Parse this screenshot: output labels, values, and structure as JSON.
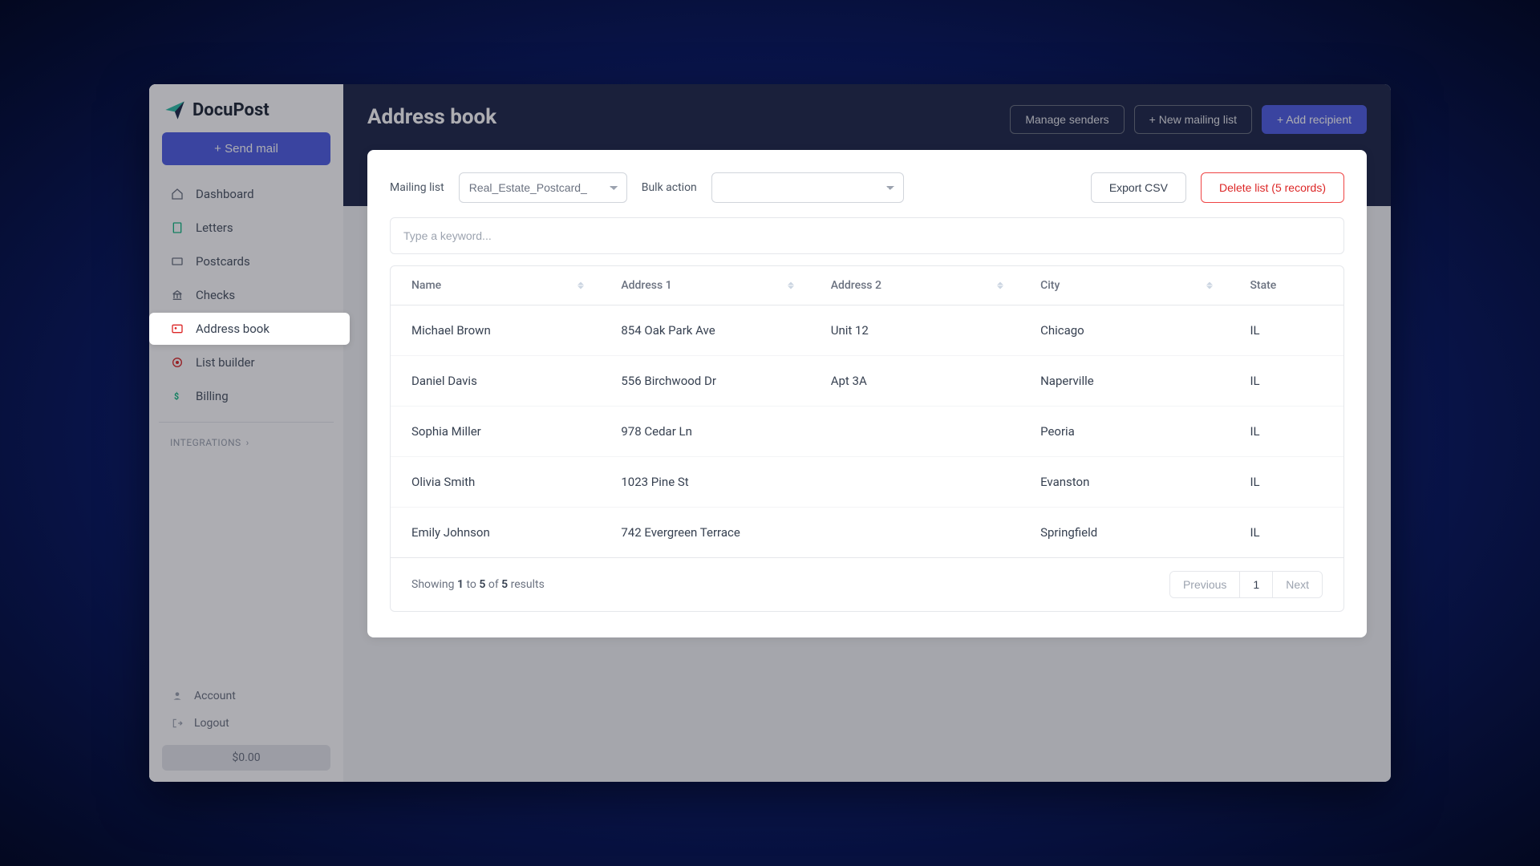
{
  "brand": {
    "name": "DocuPost"
  },
  "sidebar": {
    "send_mail": "+ Send mail",
    "items": [
      {
        "label": "Dashboard"
      },
      {
        "label": "Letters"
      },
      {
        "label": "Postcards"
      },
      {
        "label": "Checks"
      },
      {
        "label": "Address book"
      },
      {
        "label": "List builder"
      },
      {
        "label": "Billing"
      }
    ],
    "section_integrations": "INTEGRATIONS",
    "footer": {
      "account": "Account",
      "logout": "Logout",
      "balance": "$0.00"
    }
  },
  "header": {
    "title": "Address book",
    "manage_senders": "Manage senders",
    "new_list": "+ New mailing list",
    "add_recipient": "+ Add recipient"
  },
  "filters": {
    "mailing_list_label": "Mailing list",
    "mailing_list_value": "Real_Estate_Postcard_",
    "bulk_action_label": "Bulk action",
    "bulk_action_value": "",
    "export": "Export CSV",
    "delete": "Delete list (5 records)",
    "search_placeholder": "Type a keyword..."
  },
  "table": {
    "columns": {
      "name": "Name",
      "address1": "Address 1",
      "address2": "Address 2",
      "city": "City",
      "state": "State"
    },
    "rows": [
      {
        "name": "Michael Brown",
        "address1": "854 Oak Park Ave",
        "address2": "Unit 12",
        "city": "Chicago",
        "state": "IL"
      },
      {
        "name": "Daniel Davis",
        "address1": "556 Birchwood Dr",
        "address2": "Apt 3A",
        "city": "Naperville",
        "state": "IL"
      },
      {
        "name": "Sophia Miller",
        "address1": "978 Cedar Ln",
        "address2": "",
        "city": "Peoria",
        "state": "IL"
      },
      {
        "name": "Olivia Smith",
        "address1": "1023 Pine St",
        "address2": "",
        "city": "Evanston",
        "state": "IL"
      },
      {
        "name": "Emily Johnson",
        "address1": "742 Evergreen Terrace",
        "address2": "",
        "city": "Springfield",
        "state": "IL"
      }
    ]
  },
  "pagination": {
    "summary_prefix": "Showing ",
    "from": "1",
    "to_word": " to ",
    "to": "5",
    "of_word": " of ",
    "total": "5",
    "results_word": " results",
    "previous": "Previous",
    "page": "1",
    "next": "Next"
  }
}
